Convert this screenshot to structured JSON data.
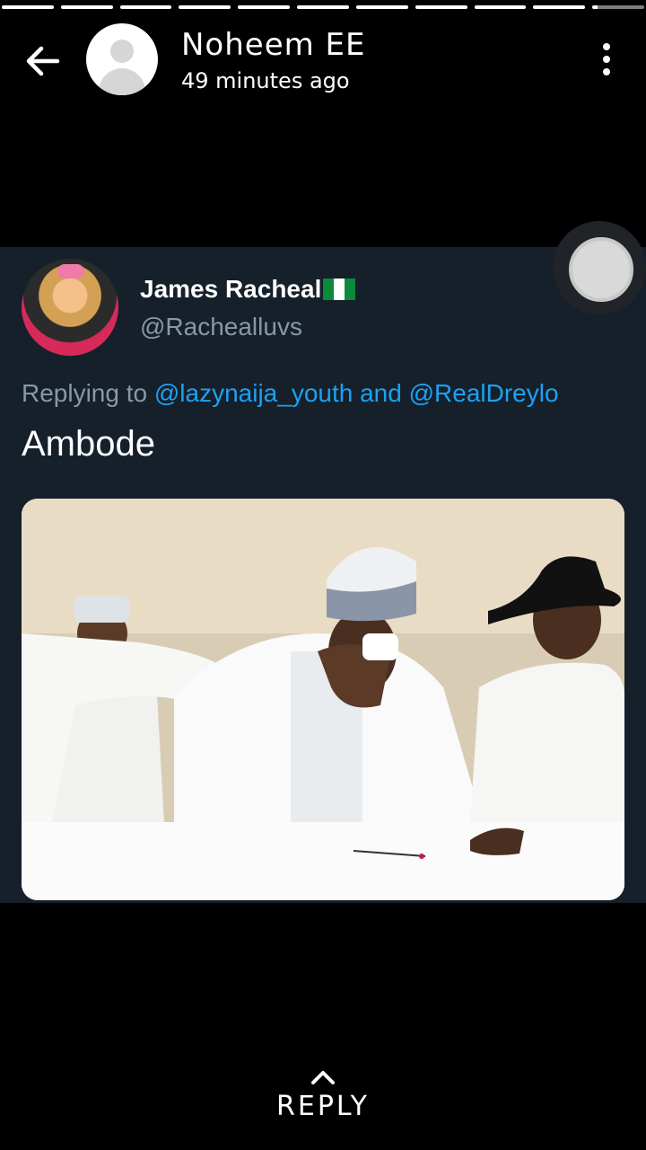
{
  "story": {
    "progress_segments": 11,
    "poster_name": "Noheem EE",
    "time_ago": "49 minutes ago"
  },
  "tweet": {
    "name": "James Racheal",
    "handle": "@Rachealluvs",
    "replying_to_prefix": "Replying to",
    "mention_1": "@lazynaija_youth",
    "mention_joiner": "and",
    "mention_2": "@RealDreylo",
    "text": "Ambode"
  },
  "footer": {
    "reply_label": "REPLY"
  },
  "colors": {
    "background": "#000000",
    "card": "#15202b",
    "mention": "#1da1f2",
    "muted": "#8899a6"
  },
  "icons": [
    "back-arrow-icon",
    "avatar-placeholder-icon",
    "more-vert-icon",
    "chevron-up-icon",
    "nigeria-flag-icon"
  ]
}
